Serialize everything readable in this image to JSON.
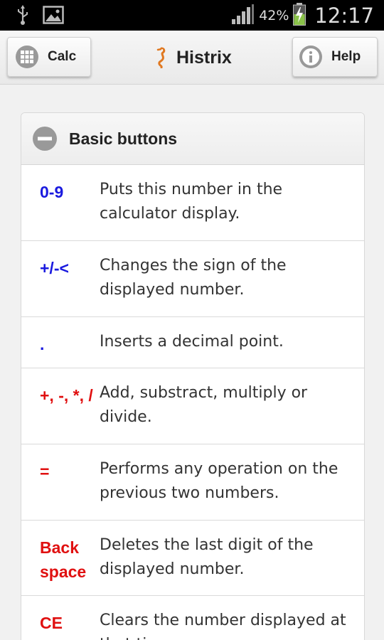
{
  "status_bar": {
    "battery_percent": "42%",
    "time": "12:17",
    "icons": [
      "usb-icon",
      "image-icon",
      "signal-icon",
      "battery-charging-icon"
    ]
  },
  "app_bar": {
    "calc_label": "Calc",
    "title": "Histrix",
    "help_label": "Help"
  },
  "section": {
    "title": "Basic buttons",
    "rows": [
      {
        "key": "0-9",
        "key_color": "#1a1adf",
        "desc": "Puts this number in the calculator display."
      },
      {
        "key": "+/-<",
        "key_color": "#1a1adf",
        "desc": "Changes the sign of the displayed number."
      },
      {
        "key": ".",
        "key_color": "#1a1adf",
        "desc": "Inserts a decimal point."
      },
      {
        "key": "+, -, *, /",
        "key_color": "#e01010",
        "desc": "Add, substract, multiply or divide."
      },
      {
        "key": "=",
        "key_color": "#e01010",
        "desc": "Performs any operation on the previous two numbers."
      },
      {
        "key": "Back space",
        "key_color": "#e01010",
        "desc": "Deletes the last digit of the displayed number."
      },
      {
        "key": "CE",
        "key_color": "#e01010",
        "desc": "Clears the number displayed at that time."
      }
    ]
  },
  "colors": {
    "status_bar_bg": "#000000",
    "battery_green": "#8bc34a",
    "blue_key": "#1a1adf",
    "red_key": "#e01010"
  }
}
